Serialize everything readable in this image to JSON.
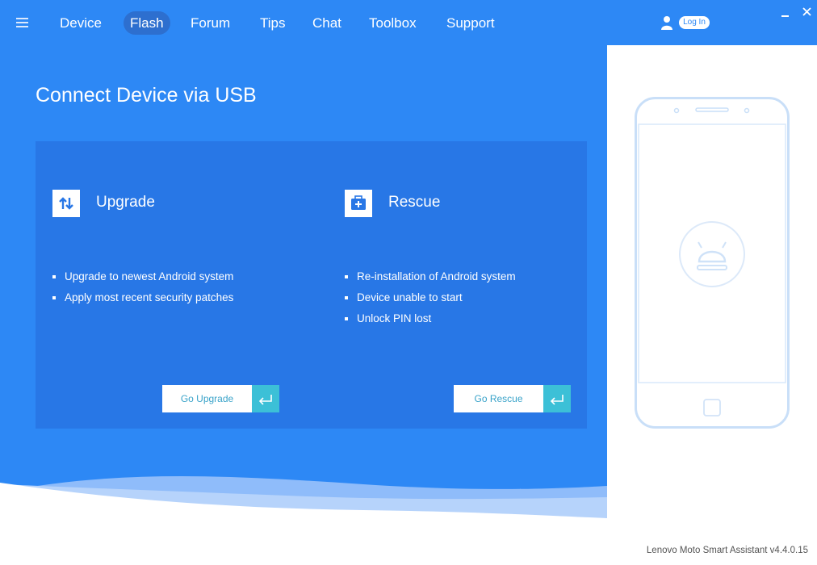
{
  "nav": {
    "items": [
      {
        "label": "Device"
      },
      {
        "label": "Flash",
        "active": true
      },
      {
        "label": "Forum"
      },
      {
        "label": "Tips"
      },
      {
        "label": "Chat"
      },
      {
        "label": "Toolbox"
      },
      {
        "label": "Support"
      }
    ],
    "login_label": "Log In",
    "icons": [
      "hamburger-menu-icon",
      "user-icon",
      "minimize-icon",
      "close-icon"
    ]
  },
  "main": {
    "title": "Connect Device via USB",
    "options": [
      {
        "title": "Upgrade",
        "icon": "upgrade-arrows-icon",
        "features": [
          "Upgrade to newest Android system",
          "Apply most recent security patches"
        ],
        "button_label": "Go Upgrade"
      },
      {
        "title": "Rescue",
        "icon": "rescue-kit-icon",
        "features": [
          "Re-installation of Android system",
          "Device unable to start",
          "Unlock PIN lost"
        ],
        "button_label": "Go Rescue"
      }
    ]
  },
  "side": {
    "illustration": "phone-with-android-icon",
    "version": "Lenovo Moto Smart Assistant v4.4.0.15"
  },
  "colors": {
    "background": "#2d88f5",
    "panel": "#2877e6",
    "active_tab": "#2d6fcf",
    "accent": "#3cc0d7",
    "button_text": "#3aa3c9"
  }
}
